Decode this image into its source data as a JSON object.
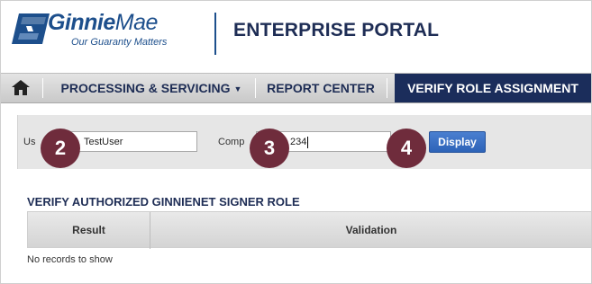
{
  "header": {
    "brand_bold": "Ginnie",
    "brand_light": "Mae",
    "tagline": "Our Guaranty Matters",
    "portal_title": "ENTERPRISE PORTAL"
  },
  "nav": {
    "home_icon": "home-icon",
    "items": [
      {
        "label": "PROCESSING & SERVICING",
        "dropdown": true
      },
      {
        "label": "REPORT CENTER"
      },
      {
        "label": "VERIFY ROLE ASSIGNMENT",
        "active": true
      }
    ]
  },
  "form": {
    "user_label": "Us",
    "user_value": "TestUser",
    "company_label": "Comp",
    "company_value": "234",
    "display_button": "Display"
  },
  "badges": [
    "2",
    "3",
    "4"
  ],
  "section": {
    "title": "VERIFY AUTHORIZED GINNIENET SIGNER ROLE",
    "columns": [
      "Result",
      "Validation"
    ],
    "empty_text": "No records to show"
  },
  "colors": {
    "brand_blue": "#1d4f8c",
    "nav_active": "#1b2d5b",
    "badge": "#6f2c3c",
    "button": "#2d63b8"
  }
}
